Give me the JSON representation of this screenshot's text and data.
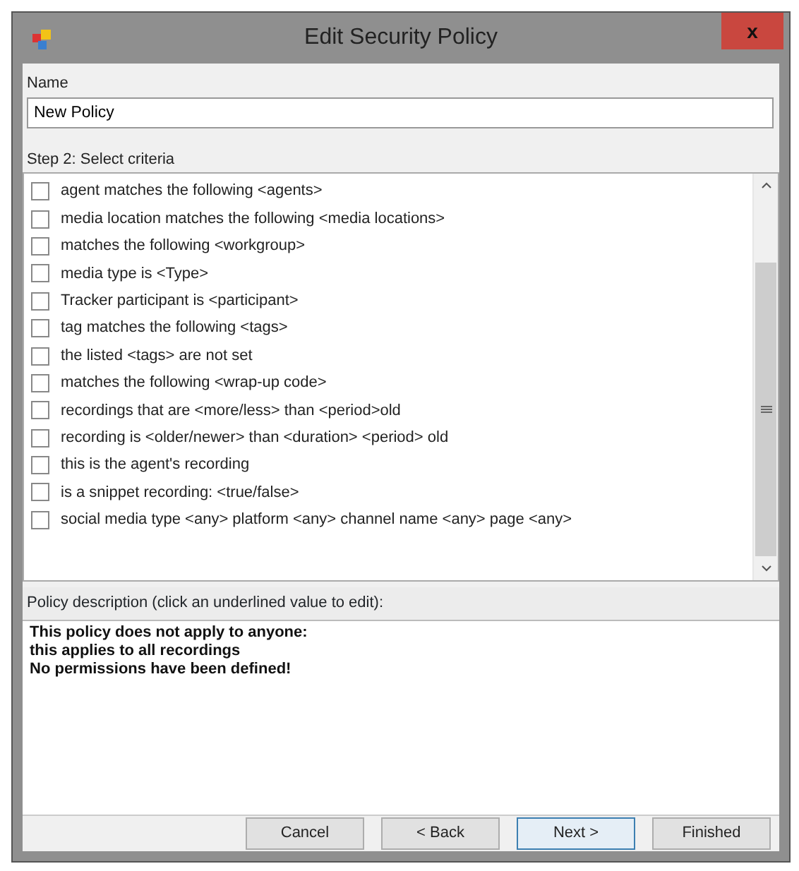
{
  "window": {
    "title": "Edit Security Policy",
    "close": "x"
  },
  "name_field": {
    "label": "Name",
    "value": "New Policy"
  },
  "criteria": {
    "label": "Step 2: Select criteria",
    "items": [
      {
        "text": "agent matches the following <agents>",
        "checked": false
      },
      {
        "text": "media location matches the following <media locations>",
        "checked": false
      },
      {
        "text": "matches the following <workgroup>",
        "checked": false
      },
      {
        "text": "media type is <Type>",
        "checked": false
      },
      {
        "text": "Tracker participant is <participant>",
        "checked": false
      },
      {
        "text": "tag matches the following <tags>",
        "checked": false
      },
      {
        "text": "the listed <tags> are not set",
        "checked": false
      },
      {
        "text": "matches the following <wrap-up code>",
        "checked": false
      },
      {
        "text": "recordings that are <more/less> than <period>old",
        "checked": false
      },
      {
        "text": "recording is <older/newer> than <duration> <period> old",
        "checked": false
      },
      {
        "text": "this is the agent's recording",
        "checked": false
      },
      {
        "text": "is a snippet recording: <true/false>",
        "checked": false
      },
      {
        "text": "social media type <any> platform <any> channel name <any> page <any>",
        "checked": false
      }
    ]
  },
  "description": {
    "label": "Policy description (click an underlined value to edit):",
    "lines": [
      "This policy does not apply to anyone:",
      "this applies to all recordings",
      "No permissions have been defined!"
    ]
  },
  "buttons": [
    {
      "label": "Cancel",
      "focused": false
    },
    {
      "label": "< Back",
      "focused": false
    },
    {
      "label": "Next >",
      "focused": true
    },
    {
      "label": "Finished",
      "focused": false
    }
  ]
}
